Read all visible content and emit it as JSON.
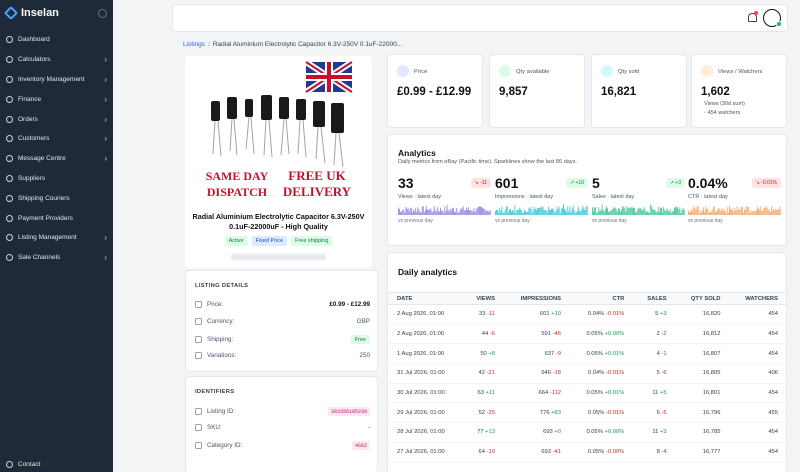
{
  "app": {
    "name": "Inselan"
  },
  "sidebar": {
    "items": [
      {
        "label": "Dashboard",
        "chevron": false
      },
      {
        "label": "Calculators",
        "chevron": true
      },
      {
        "label": "Inventory Management",
        "chevron": true
      },
      {
        "label": "Finance",
        "chevron": true
      },
      {
        "label": "Orders",
        "chevron": true
      },
      {
        "label": "Customers",
        "chevron": true
      },
      {
        "label": "Message Centre",
        "chevron": true
      },
      {
        "label": "Suppliers",
        "chevron": false
      },
      {
        "label": "Shipping Couriers",
        "chevron": false
      },
      {
        "label": "Payment Providers",
        "chevron": false
      },
      {
        "label": "Listing Management",
        "chevron": true
      },
      {
        "label": "Sale Channels",
        "chevron": true
      }
    ],
    "bottom": "Contact"
  },
  "breadcrumb": {
    "root": "Listings",
    "current": "Radial Aluminium Electrolytic Capacitor 6.3V-250V 0.1uF-22000..."
  },
  "product": {
    "image_text": {
      "same_day": "SAME DAY",
      "dispatch": "DISPATCH",
      "free_uk": "FREE UK",
      "delivery": "DELIVERY"
    },
    "title": "Radial Aluminium Electrolytic Capacitor 6.3V-250V 0.1uF-22000uF - High Quality",
    "badges": [
      "Active",
      "Fixed Price",
      "Free shipping"
    ]
  },
  "listing_details": {
    "heading": "LISTING DETAILS",
    "price_label": "Price:",
    "price_value": "£0.99 - £12.99",
    "currency_label": "Currency:",
    "currency_value": "GBP",
    "shipping_label": "Shipping:",
    "shipping_value": "Free",
    "variations_label": "Variations:",
    "variations_value": "250"
  },
  "identifiers": {
    "heading": "IDENTIFIERS",
    "listing_id_label": "Listing ID:",
    "listing_id_value": "383356185239",
    "sku_label": "SKU:",
    "sku_value": "-",
    "category_label": "Category ID:",
    "category_value": "4662"
  },
  "stats": {
    "price": {
      "label": "Price",
      "value": "£0.99 - £12.99"
    },
    "qty_available": {
      "label": "Qty available",
      "value": "9,857"
    },
    "qty_sold": {
      "label": "Qty sold",
      "value": "16,821"
    },
    "views": {
      "label": "Views / Watchers",
      "value": "1,602",
      "sub1": "Views (30d sum)",
      "sub2": "454 watchers"
    }
  },
  "analytics": {
    "title": "Analytics",
    "subtitle": "Daily metrics from eBay (Pacific time). Sparklines show the last 86 days.",
    "kpis": [
      {
        "value": "33",
        "label": "Views · latest day",
        "delta": "-11",
        "dir": "down",
        "compare": "vs previous day",
        "color": "#8b7fe0"
      },
      {
        "value": "601",
        "label": "Impressions · latest day",
        "delta": "+10",
        "dir": "up",
        "compare": "vs previous day",
        "color": "#2ec4d6"
      },
      {
        "value": "5",
        "label": "Sales · latest day",
        "delta": "+3",
        "dir": "up",
        "compare": "vs previous day",
        "color": "#34c38f"
      },
      {
        "value": "0.04%",
        "label": "CTR · latest day",
        "delta": "-0.01%",
        "dir": "down",
        "compare": "vs previous day",
        "color": "#f4a261"
      }
    ]
  },
  "daily": {
    "title": "Daily analytics",
    "columns": [
      "DATE",
      "VIEWS",
      "IMPRESSIONS",
      "CTR",
      "SALES",
      "QTY SOLD",
      "WATCHERS"
    ],
    "rows": [
      {
        "date": "2 Aug 2026, 01:00",
        "views": "33",
        "views_d": "-11",
        "views_dir": "down",
        "impr": "601",
        "impr_d": "+10",
        "impr_dir": "up",
        "ctr": "0.04%",
        "ctr_d": "-0.01%",
        "ctr_dir": "down",
        "sales": "5",
        "sales_d": "+3",
        "sales_dir": "up",
        "qty": "16,820",
        "watchers": "454"
      },
      {
        "date": "2 Aug 2026, 01:00",
        "views": "44",
        "views_d": "-6",
        "views_dir": "down",
        "impr": "591",
        "impr_d": "-46",
        "impr_dir": "down",
        "ctr": "0.05%",
        "ctr_d": "+0.00%",
        "ctr_dir": "up",
        "sales": "2",
        "sales_d": "-2",
        "sales_dir": "down",
        "qty": "16,812",
        "watchers": "454"
      },
      {
        "date": "1 Aug 2026, 01:00",
        "views": "50",
        "views_d": "+8",
        "views_dir": "up",
        "impr": "637",
        "impr_d": "-9",
        "impr_dir": "down",
        "ctr": "0.05%",
        "ctr_d": "+0.01%",
        "ctr_dir": "up",
        "sales": "4",
        "sales_d": "-1",
        "sales_dir": "down",
        "qty": "16,807",
        "watchers": "454"
      },
      {
        "date": "31 Jul 2026, 01:00",
        "views": "42",
        "views_d": "-21",
        "views_dir": "down",
        "impr": "646",
        "impr_d": "-18",
        "impr_dir": "down",
        "ctr": "0.04%",
        "ctr_d": "-0.01%",
        "ctr_dir": "down",
        "sales": "5",
        "sales_d": "-6",
        "sales_dir": "down",
        "qty": "16,805",
        "watchers": "406"
      },
      {
        "date": "30 Jul 2026, 01:00",
        "views": "63",
        "views_d": "+11",
        "views_dir": "up",
        "impr": "664",
        "impr_d": "-112",
        "impr_dir": "down",
        "ctr": "0.05%",
        "ctr_d": "+0.01%",
        "ctr_dir": "up",
        "sales": "11",
        "sales_d": "+5",
        "sales_dir": "up",
        "qty": "16,801",
        "watchers": "454"
      },
      {
        "date": "29 Jul 2026, 01:00",
        "views": "52",
        "views_d": "-25",
        "views_dir": "down",
        "impr": "776",
        "impr_d": "+83",
        "impr_dir": "up",
        "ctr": "0.05%",
        "ctr_d": "-0.01%",
        "ctr_dir": "down",
        "sales": "6",
        "sales_d": "-5",
        "sales_dir": "down",
        "qty": "16,796",
        "watchers": "455"
      },
      {
        "date": "28 Jul 2026, 01:00",
        "views": "77",
        "views_d": "+13",
        "views_dir": "up",
        "impr": "693",
        "impr_d": "+0",
        "impr_dir": "up",
        "ctr": "0.05%",
        "ctr_d": "+0.00%",
        "ctr_dir": "up",
        "sales": "11",
        "sales_d": "+3",
        "sales_dir": "up",
        "qty": "16,785",
        "watchers": "454"
      },
      {
        "date": "27 Jul 2026, 01:00",
        "views": "64",
        "views_d": "-10",
        "views_dir": "down",
        "impr": "693",
        "impr_d": "-41",
        "impr_dir": "down",
        "ctr": "0.05%",
        "ctr_d": "-0.00%",
        "ctr_dir": "down",
        "sales": "8",
        "sales_d": "-4",
        "sales_dir": "down",
        "qty": "16,777",
        "watchers": "454"
      }
    ]
  }
}
